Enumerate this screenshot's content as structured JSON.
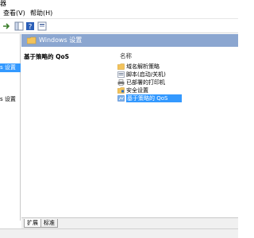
{
  "window": {
    "title_fragment": "器"
  },
  "menu": {
    "items": [
      "查看(V)",
      "帮助(H)"
    ]
  },
  "tree": {
    "items": [
      {
        "label": "s 设置",
        "selected": true
      },
      {
        "label": "s 设置",
        "selected": false
      }
    ]
  },
  "header": {
    "title": "Windows 设置"
  },
  "details": {
    "title": "基于策略的 QoS"
  },
  "list": {
    "column_header": "名称",
    "items": [
      {
        "label": "域名解析策略",
        "icon": "folder-icon",
        "selected": false
      },
      {
        "label": "脚本(启动/关机)",
        "icon": "script-icon",
        "selected": false
      },
      {
        "label": "已部署的打印机",
        "icon": "printer-icon",
        "selected": false
      },
      {
        "label": "安全设置",
        "icon": "security-icon",
        "selected": false
      },
      {
        "label": "基于策略的 QoS",
        "icon": "qos-icon",
        "selected": true
      }
    ]
  },
  "tabs": {
    "extended": "扩展",
    "standard": "标准"
  },
  "colors": {
    "header_band": "#8ba6d0",
    "selection": "#3399ff"
  }
}
